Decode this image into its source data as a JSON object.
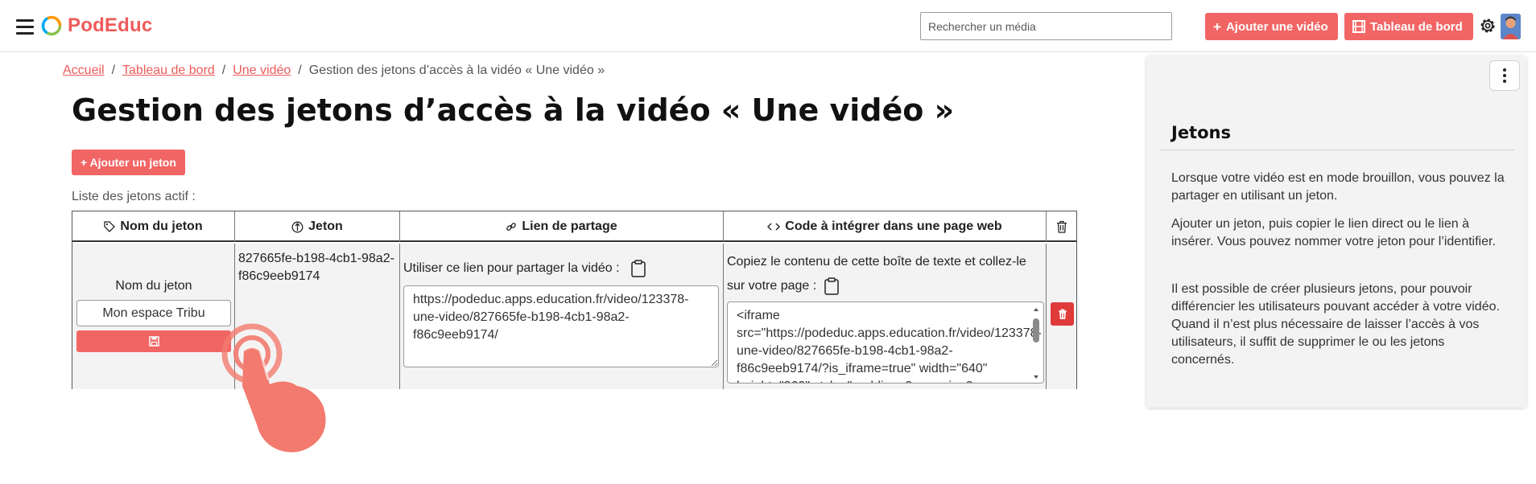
{
  "header": {
    "brand": "PodEduc",
    "search_placeholder": "Rechercher un média",
    "add_video_label": "Ajouter une vidéo",
    "dashboard_label": "Tableau de bord"
  },
  "breadcrumb": {
    "items": [
      "Accueil",
      "Tableau de bord",
      "Une vidéo"
    ],
    "current": "Gestion des jetons d’accès à la vidéo « Une vidéo »"
  },
  "page": {
    "title": "Gestion des jetons d’accès à la vidéo « Une vidéo »",
    "add_token_label": "+ Ajouter un jeton",
    "list_label": "Liste des jetons actif :"
  },
  "table": {
    "headers": {
      "name": "Nom du jeton",
      "token": "Jeton",
      "share": "Lien de partage",
      "embed": "Code à intégrer dans une page web"
    },
    "row": {
      "name_label": "Nom du jeton",
      "name_value": "Mon espace Tribu",
      "token": "827665fe-b198-4cb1-98a2-f86c9eeb9174",
      "share_text": "Utiliser ce lien pour partager la vidéo :",
      "share_link": "https://podeduc.apps.education.fr/video/123378-une-video/827665fe-b198-4cb1-98a2-f86c9eeb9174/",
      "embed_text": "Copiez le contenu de cette boîte de texte et collez-le sur votre page :",
      "embed_code": "<iframe src=\"https://podeduc.apps.education.fr/video/123378-une-video/827665fe-b198-4cb1-98a2-f86c9eeb9174/?is_iframe=true\" width=\"640\" height=\"360\" style=\"padding: 0; margin: 0; border:0\" allowfullscreen title=\"Une vidéo\"></iframe>"
    }
  },
  "sidebar": {
    "title": "Jetons",
    "paragraphs": [
      "Lorsque votre vidéo est en mode brouillon, vous pouvez la partager en utilisant un jeton.",
      "Ajouter un jeton, puis copier le lien direct ou le lien à insérer. Vous pouvez nommer votre jeton pour l’identifier.",
      "Il est possible de créer plusieurs jetons, pour pouvoir différencier les utilisateurs pouvant accéder à votre vidéo. Quand il n’est plus nécessaire de laisser l’accès à vos utilisateurs, il suffit de supprimer le ou les jetons concernés."
    ]
  },
  "colors": {
    "accent": "#f26565",
    "brand": "#ef5a5a",
    "danger": "#e03a3a",
    "panel_bg": "#f3f3f3"
  },
  "icons": [
    "menu-icon",
    "logo-icon",
    "plus-icon",
    "film-icon",
    "gear-icon",
    "tag-icon",
    "token-icon",
    "link-icon",
    "code-icon",
    "trash-icon",
    "clipboard-icon",
    "save-icon",
    "kebab-icon",
    "pointer-hand-icon"
  ]
}
